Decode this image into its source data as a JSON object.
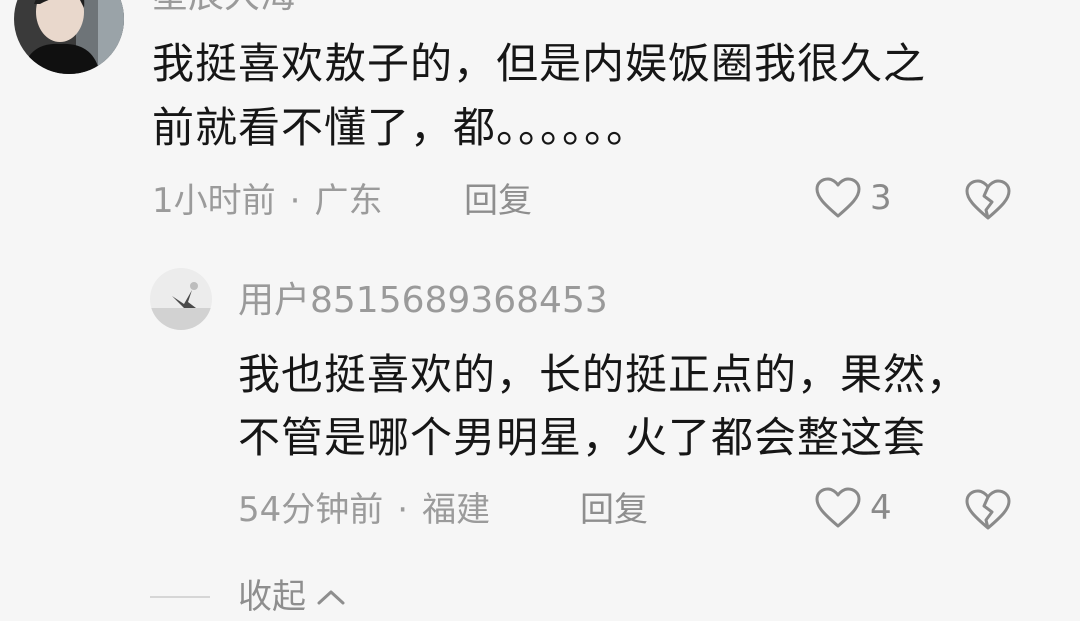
{
  "top_comment": {
    "username": "星辰大海",
    "text_line1": "我挺喜欢敖子的，但是内娱饭圈我很久之",
    "text_line2": "前就看不懂了，都。。。。。。",
    "time": "1小时前",
    "location": "广东",
    "reply_label": "回复",
    "like_count": "3"
  },
  "reply_comment": {
    "username": "用户8515689368453",
    "text_line1": "我也挺喜欢的，长的挺正点的，果然，",
    "text_line2": "不管是哪个男明星，火了都会整这套",
    "time": "54分钟前",
    "location": "福建",
    "reply_label": "回复",
    "like_count": "4"
  },
  "collapse_label": "收起",
  "separator": "·",
  "icons": {
    "like": "heart-outline-icon",
    "dislike": "broken-heart-icon",
    "collapse": "chevron-up-icon"
  },
  "colors": {
    "background": "#f6f6f6",
    "text_primary": "#161616",
    "text_secondary": "#9a9a9a"
  }
}
